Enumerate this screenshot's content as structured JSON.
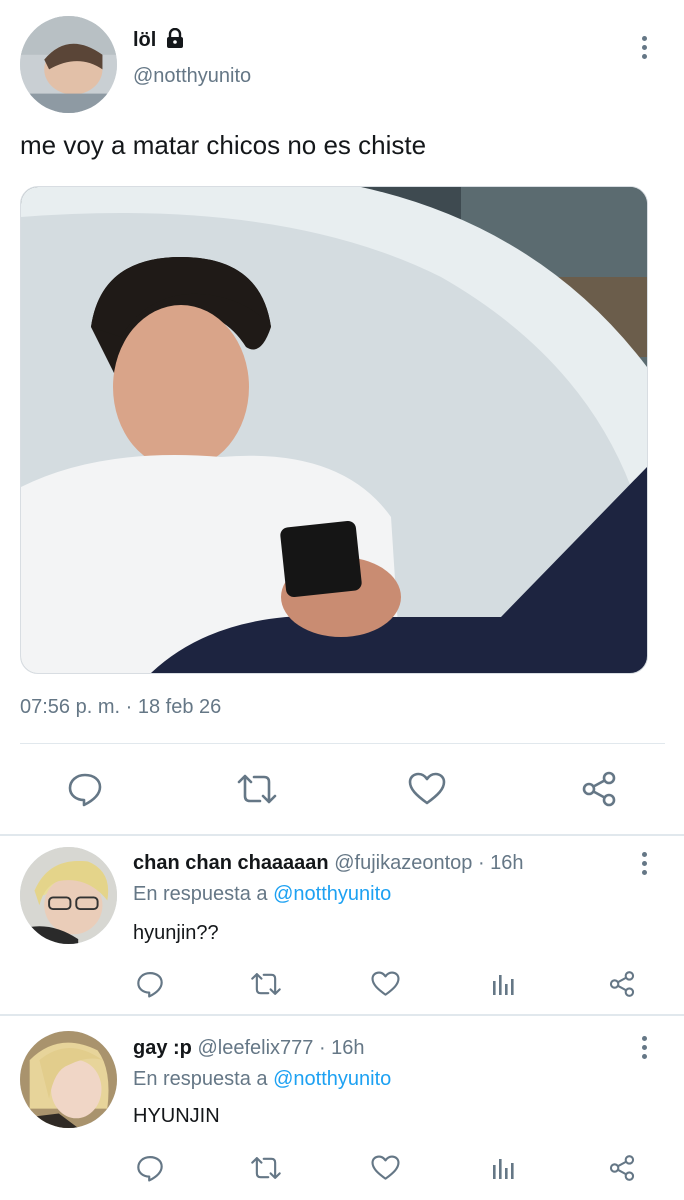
{
  "main_tweet": {
    "display_name": "löl",
    "handle": "@notthyunito",
    "text": "me voy a matar chicos no es chiste",
    "timestamp": "07:56 p. m. · 18 feb 26",
    "media_icon": "photo-man-with-phone-in-bathtub"
  },
  "replies": [
    {
      "display_name": "chan chan chaaaaan",
      "handle": "@fujikazeontop",
      "time": "· 16h",
      "in_reply_prefix": "En respuesta a",
      "in_reply_mention": "@notthyunito",
      "text": "hyunjin??"
    },
    {
      "display_name": "gay :p",
      "handle": "@leefelix777",
      "time": "· 16h",
      "in_reply_prefix": "En respuesta a",
      "in_reply_mention": "@notthyunito",
      "text": "HYUNJIN"
    }
  ],
  "icons": {
    "lock": "lock-icon",
    "more": "more-vertical-icon",
    "reply": "reply-icon",
    "retweet": "retweet-icon",
    "like": "heart-icon",
    "share": "share-icon",
    "stats": "stats-icon"
  },
  "colors": {
    "text": "#14171a",
    "secondary": "#657786",
    "link": "#1da1f2",
    "divider": "#e1e8ed"
  }
}
